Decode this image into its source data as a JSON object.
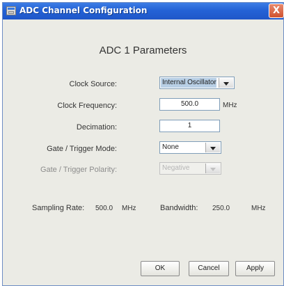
{
  "window": {
    "title": "ADC Channel Configuration",
    "close_glyph": "X"
  },
  "panel": {
    "heading": "ADC 1 Parameters"
  },
  "form": {
    "clock_source_label": "Clock Source:",
    "clock_source_value": "Internal Oscillator",
    "clock_frequency_label": "Clock Frequency:",
    "clock_frequency_value": "500.0",
    "clock_frequency_unit": "MHz",
    "decimation_label": "Decimation:",
    "decimation_value": "1",
    "gate_mode_label": "Gate / Trigger Mode:",
    "gate_mode_value": "None",
    "gate_polarity_label": "Gate / Trigger Polarity:",
    "gate_polarity_value": "Negative"
  },
  "summary": {
    "sampling_rate_label": "Sampling Rate:",
    "sampling_rate_value": "500.0",
    "sampling_rate_unit": "MHz",
    "bandwidth_label": "Bandwidth:",
    "bandwidth_value": "250.0",
    "bandwidth_unit": "MHz"
  },
  "buttons": {
    "ok": "OK",
    "cancel": "Cancel",
    "apply": "Apply"
  },
  "colors": {
    "titlebar": "#2462d6",
    "dialog_bg": "#ebebe5",
    "selection": "#b8cfe5",
    "close_button": "#d0522e"
  }
}
